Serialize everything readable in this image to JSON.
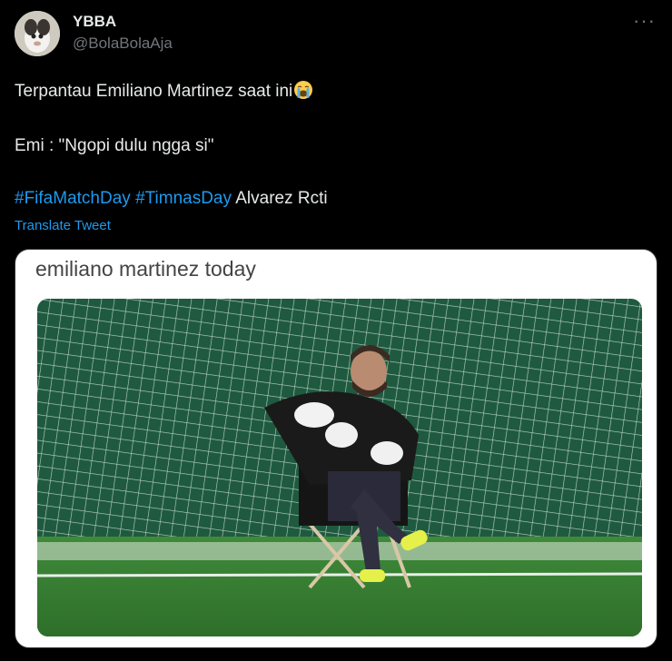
{
  "tweet": {
    "author": {
      "name": "YBBA",
      "handle": "@BolaBolaAja"
    },
    "more_label": "···",
    "lines": {
      "line1": "Terpantau Emiliano Martinez saat ini",
      "line2": "Emi : \"Ngopi dulu ngga si\"",
      "hashtag1": "#FifaMatchDay",
      "hashtag2": "#TimnasDay",
      "trailing": "Alvarez Rcti"
    },
    "emoji_icon": "loudly-crying-face-icon",
    "translate_label": "Translate Tweet",
    "media": {
      "caption": "emiliano martinez today"
    }
  },
  "colors": {
    "background": "#000000",
    "text": "#e7e9ea",
    "secondary_text": "#71767b",
    "link": "#1d9bf0"
  }
}
